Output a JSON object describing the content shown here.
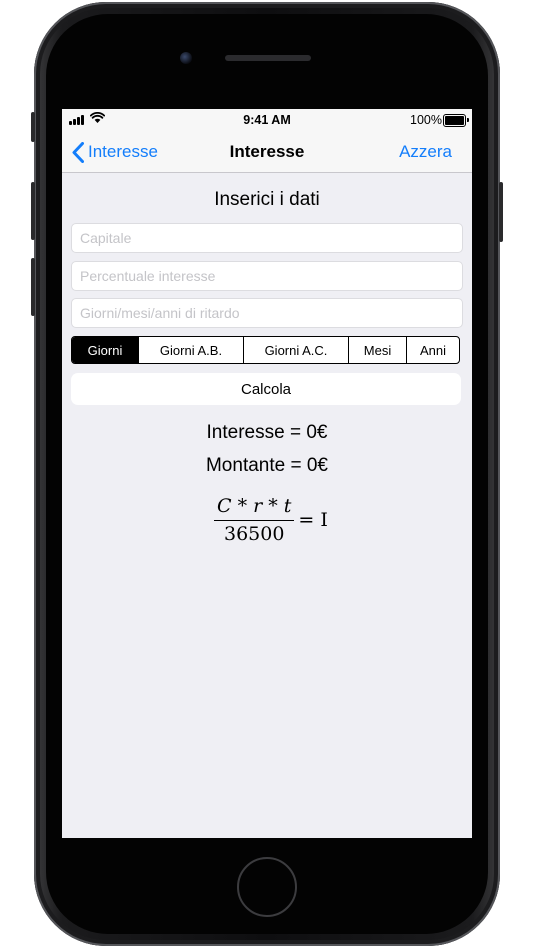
{
  "status_bar": {
    "time": "9:41 AM",
    "battery": "100%"
  },
  "nav": {
    "back_label": "Interesse",
    "title": "Interesse",
    "right_label": "Azzera"
  },
  "form": {
    "section_title": "Inserici i dati",
    "fields": [
      {
        "placeholder": "Capitale",
        "value": ""
      },
      {
        "placeholder": "Percentuale interesse",
        "value": ""
      },
      {
        "placeholder": "Giorni/mesi/anni di ritardo",
        "value": ""
      }
    ],
    "segments": [
      "Giorni",
      "Giorni A.B.",
      "Giorni A.C.",
      "Mesi",
      "Anni"
    ],
    "selected_segment": "Giorni",
    "calculate_label": "Calcola"
  },
  "results": {
    "interest": "Interesse = 0€",
    "amount": "Montante = 0€"
  },
  "formula": {
    "numerator": "C * r * t",
    "denominator": "36500",
    "equals": "= I"
  },
  "colors": {
    "accent": "#147efb",
    "background": "#efeff4",
    "selected_segment": "#000000"
  }
}
